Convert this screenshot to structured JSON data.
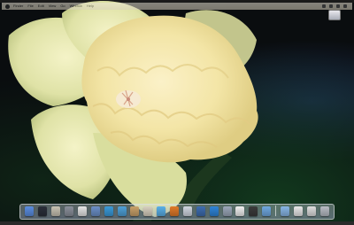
{
  "menubar": {
    "items": [
      "Finder",
      "File",
      "Edit",
      "View",
      "Go",
      "Window",
      "Help"
    ]
  },
  "wallpaper": {
    "subject": "daffodil",
    "colors": {
      "petal": "#eef0b8",
      "trumpet": "#f3e5a6",
      "background": "#0a0d0f"
    }
  },
  "dock": {
    "icons": [
      {
        "name": "finder-icon",
        "color": "#5a8de0"
      },
      {
        "name": "dashboard-icon",
        "color": "#2b2f3a"
      },
      {
        "name": "address-book-icon",
        "color": "#c8c2b2"
      },
      {
        "name": "system-preferences-icon",
        "color": "#8a8f9a"
      },
      {
        "name": "ical-icon",
        "color": "#e5e5e5"
      },
      {
        "name": "mail-icon",
        "color": "#6b8fc8"
      },
      {
        "name": "safari-icon",
        "color": "#3a9ad9"
      },
      {
        "name": "itunes-icon",
        "color": "#4ea0d8"
      },
      {
        "name": "iphoto-icon",
        "color": "#c9a16a"
      },
      {
        "name": "garageband-icon",
        "color": "#d8d0c0"
      },
      {
        "name": "itunes-store-icon",
        "color": "#5ab0e8"
      },
      {
        "name": "firefox-icon",
        "color": "#e07a2a"
      },
      {
        "name": "chat-icon",
        "color": "#d0d6e0"
      },
      {
        "name": "network-icon",
        "color": "#3e6db0"
      },
      {
        "name": "app-store-icon",
        "color": "#2f84d8"
      },
      {
        "name": "preview-icon",
        "color": "#9aa6b8"
      },
      {
        "name": "textedit-icon",
        "color": "#f0f0f0"
      },
      {
        "name": "terminal-icon",
        "color": "#3b3b3b"
      },
      {
        "name": "folder-icon",
        "color": "#6fa8e0"
      },
      {
        "name": "folder-stack-icon",
        "color": "#88b6e6"
      },
      {
        "name": "document-icon",
        "color": "#e8e8e8"
      },
      {
        "name": "downloads-icon",
        "color": "#dedede"
      },
      {
        "name": "trash-icon",
        "color": "#b8bcc4"
      }
    ]
  }
}
